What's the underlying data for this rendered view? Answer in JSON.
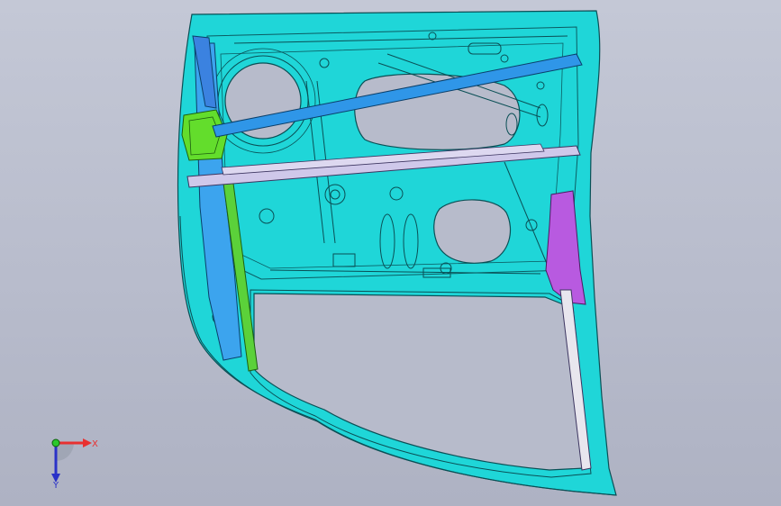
{
  "viewport": {
    "background_top": "#c4c8d6",
    "background_bottom": "#aeb2c3"
  },
  "model": {
    "parts": [
      {
        "name": "door-inner-panel",
        "color": "#1fd6d8"
      },
      {
        "name": "window-frame",
        "color": "#1fd6d8"
      },
      {
        "name": "side-impact-beam",
        "color": "#2f96e8"
      },
      {
        "name": "waist-reinforcement",
        "color": "#cfc8ea"
      },
      {
        "name": "hinge-bracket",
        "color": "#63dd2c"
      },
      {
        "name": "glass-run-channel",
        "color": "#5bd13a"
      },
      {
        "name": "latch-reinforcement",
        "color": "#b85ae0"
      },
      {
        "name": "rear-sash-channel",
        "color": "#e8e6ee"
      },
      {
        "name": "front-pillar-reinforcement",
        "color": "#3ca4ee"
      }
    ]
  },
  "triad": {
    "x_label": "X",
    "y_label": "Y",
    "x_color": "#e83030",
    "y_color": "#2a32c8",
    "origin_color": "#2cc82c"
  }
}
